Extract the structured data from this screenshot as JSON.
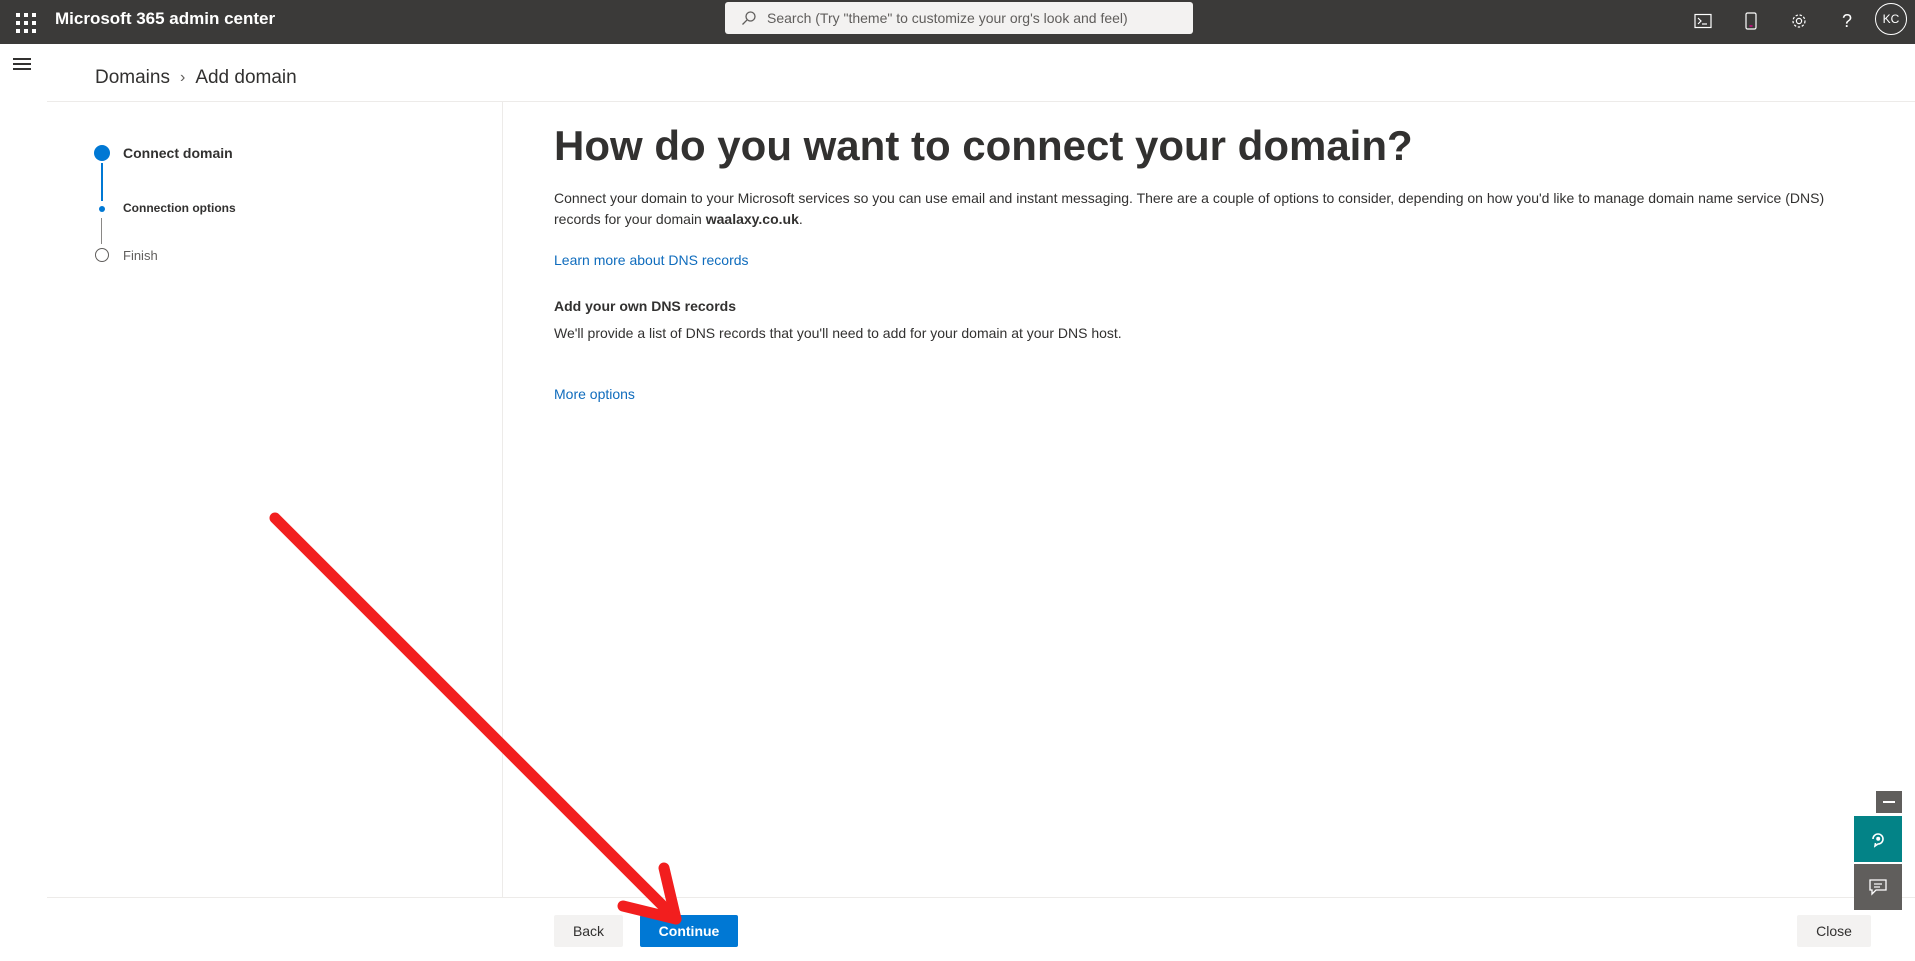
{
  "app": {
    "title": "Microsoft 365 admin center"
  },
  "search": {
    "placeholder": "Search (Try \"theme\" to customize your org's look and feel)"
  },
  "user": {
    "initials": "KC"
  },
  "topbar_icons": [
    "terminal-icon",
    "mobile-icon",
    "settings-icon",
    "help-icon"
  ],
  "help_glyph": "?",
  "breadcrumb": {
    "parent": "Domains",
    "current": "Add domain"
  },
  "steps": [
    {
      "label": "Connect domain",
      "state": "completed"
    },
    {
      "label": "Connection options",
      "state": "current"
    },
    {
      "label": "Finish",
      "state": "pending"
    }
  ],
  "main": {
    "heading": "How do you want to connect your domain?",
    "description_prefix": "Connect your domain to your Microsoft services so you can use email and instant messaging. There are a couple of options to consider, depending on how you'd like to manage domain name service (DNS) records for your domain ",
    "domain": "waalaxy.co.uk",
    "description_suffix": ".",
    "learn_more_link": "Learn more about DNS records",
    "option_title": "Add your own DNS records",
    "option_description": "We'll provide a list of DNS records that you'll need to add for your domain at your DNS host.",
    "more_options_link": "More options"
  },
  "footer": {
    "back_label": "Back",
    "continue_label": "Continue",
    "close_label": "Close"
  },
  "colors": {
    "topbar": "#3b3a39",
    "accent": "#0078d4",
    "link": "#0f6cbd",
    "help_panel": "#038387",
    "annotation_arrow": "#f21e1e"
  }
}
